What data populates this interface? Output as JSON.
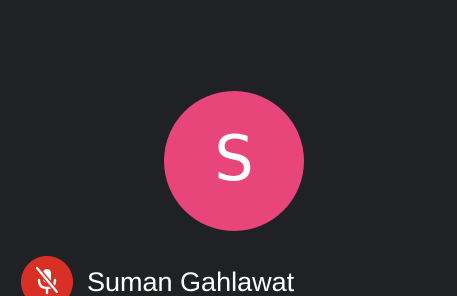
{
  "participant": {
    "name": "Suman Gahlawat",
    "initial": "S",
    "avatar_color": "#E8457A",
    "mic_state": "muted",
    "mic_icon": "mic-off-icon",
    "mic_badge_color": "#D93025"
  },
  "tile": {
    "background_color": "#202124"
  }
}
